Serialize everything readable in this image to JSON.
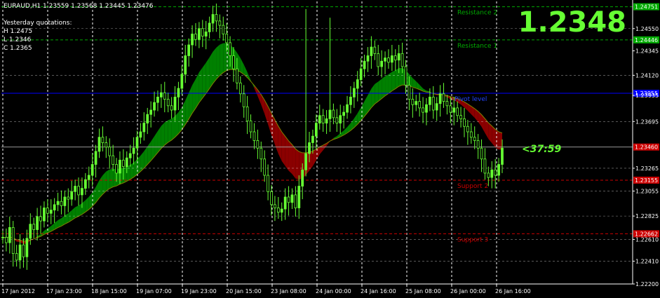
{
  "header": {
    "symbol_line": "EURAUD,H1  1.23559 1.23568 1.23445 1.23476",
    "yesterday_title": "Yesterday quotations:",
    "high": "H 1.2475",
    "low": "L 1.2346",
    "close": "C 1.2365"
  },
  "big_price": "1.2348",
  "countdown": "<37:59",
  "colors": {
    "background": "#000000",
    "candle": "#66ff33",
    "cloud_bull": "#008000",
    "cloud_bear": "#8b0000",
    "grid": "#ffffff",
    "resistance": "#00aa00",
    "support": "#cc0000",
    "pivot": "#0000ff"
  },
  "chart_data": {
    "type": "candlestick",
    "symbol": "EURAUD",
    "timeframe": "H1",
    "ylim": [
      1.222,
      1.248
    ],
    "y_ticks": [
      "1.24751",
      "1.24550",
      "1.24446",
      "1.24345",
      "1.24120",
      "1.23935",
      "1.23695",
      "1.23460",
      "1.23265",
      "1.23155",
      "1.23055",
      "1.22825",
      "1.22610",
      "1.22410",
      "1.22200"
    ],
    "x_ticks": [
      "17 Jan 2012",
      "17 Jan 23:00",
      "18 Jan 15:00",
      "19 Jan 07:00",
      "19 Jan 23:00",
      "20 Jan 15:00",
      "23 Jan 08:00",
      "24 Jan 00:00",
      "24 Jan 16:00",
      "25 Jan 08:00",
      "26 Jan 00:00",
      "26 Jan 16:00"
    ],
    "levels": [
      {
        "name": "Resistance 2",
        "price": 1.24751,
        "label": "1.24751",
        "kind": "resistance"
      },
      {
        "name": "Resistance 1",
        "price": 1.24446,
        "label": "1.24446",
        "kind": "resistance"
      },
      {
        "name": "Pivot level",
        "price": 1.23955,
        "label": "1.23955",
        "kind": "pivot"
      },
      {
        "name": "Support 2",
        "price": 1.23155,
        "label": "1.23155",
        "kind": "support"
      },
      {
        "name": "Support 3",
        "price": 1.22662,
        "label": "1.22662",
        "kind": "support"
      }
    ],
    "current_price": {
      "label": "1.23460",
      "value": 1.2346
    },
    "close_series": [
      1.2263,
      1.2258,
      1.2272,
      1.2248,
      1.2242,
      1.2256,
      1.2245,
      1.2262,
      1.2275,
      1.227,
      1.2282,
      1.2278,
      1.229,
      1.2285,
      1.2288,
      1.2293,
      1.2296,
      1.2292,
      1.23,
      1.2298,
      1.2305,
      1.231,
      1.2302,
      1.2308,
      1.2316,
      1.232,
      1.233,
      1.2342,
      1.2355,
      1.235,
      1.2346,
      1.2338,
      1.233,
      1.2322,
      1.2334,
      1.2328,
      1.2336,
      1.234,
      1.2345,
      1.2355,
      1.236,
      1.2368,
      1.2376,
      1.238,
      1.2387,
      1.2392,
      1.2396,
      1.239,
      1.2384,
      1.238,
      1.2392,
      1.24,
      1.2413,
      1.243,
      1.244,
      1.245,
      1.2445,
      1.2455,
      1.2448,
      1.2452,
      1.246,
      1.2468,
      1.2462,
      1.2458,
      1.245,
      1.2442,
      1.243,
      1.2418,
      1.2405,
      1.2395,
      1.2383,
      1.237,
      1.236,
      1.2352,
      1.2345,
      1.2335,
      1.232,
      1.2305,
      1.2293,
      1.229,
      1.2286,
      1.2289,
      1.23,
      1.2295,
      1.2302,
      1.229,
      1.231,
      1.2325,
      1.234,
      1.235,
      1.2356,
      1.2368,
      1.2375,
      1.2368,
      1.2372,
      1.238,
      1.2373,
      1.2368,
      1.2375,
      1.2378,
      1.2385,
      1.2392,
      1.24,
      1.2408,
      1.2418,
      1.2425,
      1.243,
      1.2438,
      1.2432,
      1.242,
      1.2425,
      1.2428,
      1.2424,
      1.243,
      1.2426,
      1.2432,
      1.242,
      1.2403,
      1.239,
      1.2385,
      1.2388,
      1.2382,
      1.2378,
      1.2385,
      1.2392,
      1.238,
      1.2386,
      1.2395,
      1.2388,
      1.2384,
      1.2378,
      1.2382,
      1.2375,
      1.2372,
      1.2365,
      1.236,
      1.2355,
      1.2352,
      1.2345,
      1.2335,
      1.2322,
      1.2318,
      1.2325,
      1.232,
      1.233,
      1.2345
    ]
  }
}
